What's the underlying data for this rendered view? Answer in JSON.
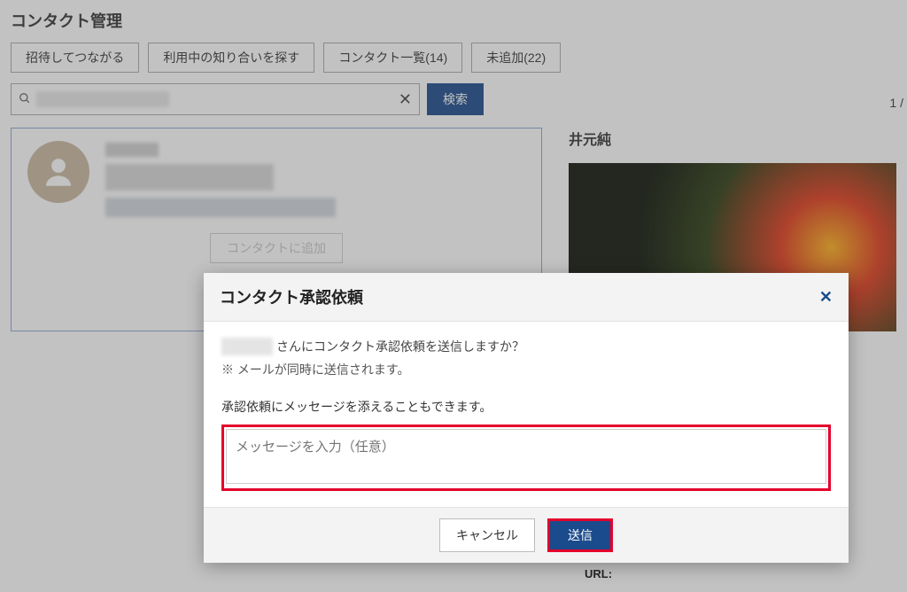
{
  "page": {
    "title": "コンタクト管理",
    "indicator": "1 /"
  },
  "tabs": {
    "invite": "招待してつながる",
    "find": "利用中の知り合いを探す",
    "list": "コンタクト一覧(14)",
    "pending": "未追加(22)"
  },
  "search": {
    "button": "検索"
  },
  "contact_card": {
    "add_button": "コンタクトに追加"
  },
  "right_panel": {
    "name": "井元純"
  },
  "modal": {
    "title": "コンタクト承認依頼",
    "confirm_suffix": "さんにコンタクト承認依頼を送信しますか？",
    "note": "※ メールが同時に送信されます。",
    "msg_label": "承認依頼にメッセージを添えることもできます。",
    "placeholder": "メッセージを入力（任意）",
    "cancel": "キャンセル",
    "send": "送信"
  },
  "footer": {
    "url_label": "URL:"
  }
}
